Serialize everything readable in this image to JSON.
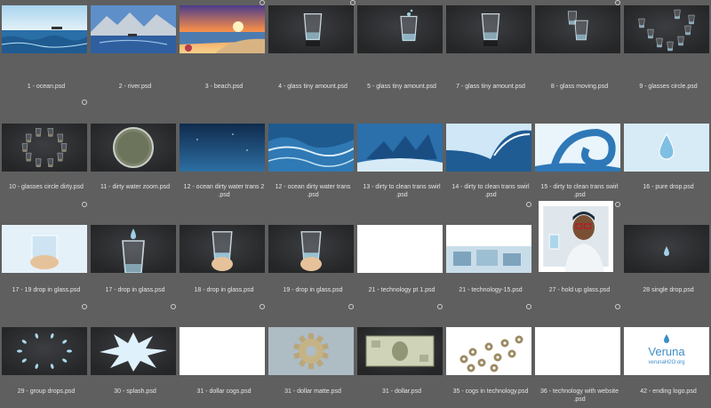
{
  "items": [
    {
      "label": "1 - ocean.psd",
      "kind": "ocean"
    },
    {
      "label": "2 - river.psd",
      "kind": "river"
    },
    {
      "label": "3 - beach.psd",
      "kind": "beach"
    },
    {
      "label": "4 - glass tiny amount.psd",
      "kind": "glass"
    },
    {
      "label": "5 - glass tiny amount.psd",
      "kind": "glass2"
    },
    {
      "label": "7 - glass tiny amount.psd",
      "kind": "glass"
    },
    {
      "label": "8 - glass moving.psd",
      "kind": "glassmove"
    },
    {
      "label": "9 - glasses circle.psd",
      "kind": "glasscircle"
    },
    {
      "label": "10 - glasses circle dirty.psd",
      "kind": "circledirty"
    },
    {
      "label": "11 - dirty water zoom.psd",
      "kind": "dirtyzoom"
    },
    {
      "label": "12 - ocean dirty water trans 2\n.psd",
      "kind": "deepblue"
    },
    {
      "label": "12 - ocean dirty water trans\n.psd",
      "kind": "waves"
    },
    {
      "label": "13 - dirty to clean trans swirl\n.psd",
      "kind": "swirl1"
    },
    {
      "label": "14 - dirty to clean trans swirl\n.psd",
      "kind": "swirl2"
    },
    {
      "label": "15 - dirty to clean trans swirl\n.psd",
      "kind": "swirl3"
    },
    {
      "label": "16 - pure drop.psd",
      "kind": "puredrop"
    },
    {
      "label": "17 - 19 drop in glass.psd",
      "kind": "hand"
    },
    {
      "label": "17 - drop in glass.psd",
      "kind": "dropglass"
    },
    {
      "label": "18 - drop in glass.psd",
      "kind": "handglass"
    },
    {
      "label": "19 - drop in glass.psd",
      "kind": "handglass"
    },
    {
      "label": "21 - technology pt 1.psd",
      "kind": "blank"
    },
    {
      "label": "21 - technology-15.psd",
      "kind": "tech"
    },
    {
      "label": "27 - hold up glass.psd",
      "kind": "person"
    },
    {
      "label": "28 single drop.psd",
      "kind": "singledrop"
    },
    {
      "label": "29 - group drops.psd",
      "kind": "groupdrops"
    },
    {
      "label": "30 - splash.psd",
      "kind": "splash"
    },
    {
      "label": "31 - dollar cogs.psd",
      "kind": "blank"
    },
    {
      "label": "31 - dollar matte.psd",
      "kind": "cog"
    },
    {
      "label": "31 - dollar.psd",
      "kind": "dollar"
    },
    {
      "label": "35 - cogs in technology.psd",
      "kind": "cogs"
    },
    {
      "label": "36 - technology with website\n.psd",
      "kind": "blank"
    },
    {
      "label": "42 - ending logo.psd",
      "kind": "logo",
      "logo_title": "Veruna",
      "logo_url": "verunaH2O.org"
    }
  ]
}
